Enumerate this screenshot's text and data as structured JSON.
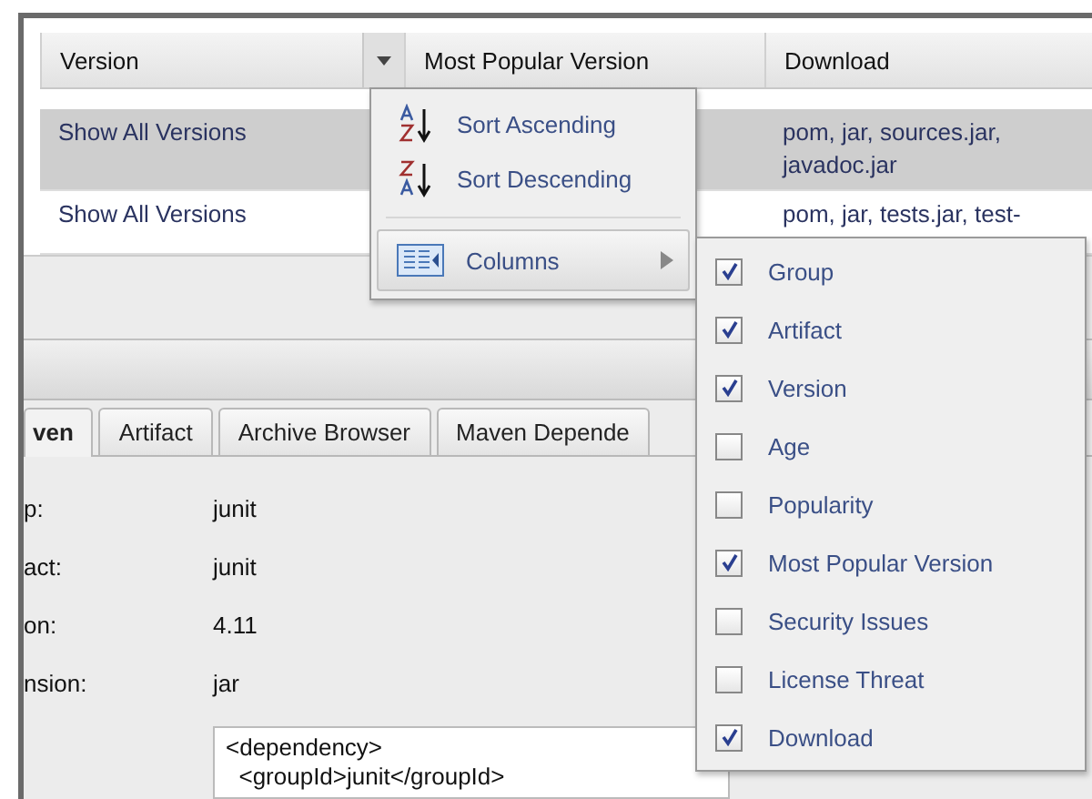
{
  "table": {
    "columns": [
      {
        "label": "Version",
        "menu_button": true
      },
      {
        "label": "Most Popular Version",
        "menu_button": false
      },
      {
        "label": "Download",
        "menu_button": false
      }
    ],
    "rows": [
      {
        "cells": [
          "Show All Versions",
          "",
          "pom, jar, sources.jar, javadoc.jar"
        ],
        "selected": true
      },
      {
        "cells": [
          "Show All Versions",
          "",
          "pom, jar, tests.jar, test-"
        ],
        "selected": false
      }
    ]
  },
  "column_menu": {
    "items": [
      {
        "kind": "sort_ascending",
        "label": "Sort Ascending",
        "highlighted": false
      },
      {
        "kind": "sort_descending",
        "label": "Sort Descending",
        "highlighted": false
      },
      {
        "kind": "separator"
      },
      {
        "kind": "submenu",
        "label": "Columns",
        "highlighted": true
      }
    ]
  },
  "columns_submenu": {
    "items": [
      {
        "label": "Group",
        "checked": true
      },
      {
        "label": "Artifact",
        "checked": true
      },
      {
        "label": "Version",
        "checked": true
      },
      {
        "label": "Age",
        "checked": false
      },
      {
        "label": "Popularity",
        "checked": false
      },
      {
        "label": "Most Popular Version",
        "checked": true
      },
      {
        "label": "Security Issues",
        "checked": false
      },
      {
        "label": "License Threat",
        "checked": false
      },
      {
        "label": "Download",
        "checked": true
      }
    ]
  },
  "tabs": [
    {
      "label": "ven",
      "selected": true
    },
    {
      "label": "Artifact",
      "selected": false
    },
    {
      "label": "Archive Browser",
      "selected": false
    },
    {
      "label": "Maven Depende",
      "selected": false
    }
  ],
  "fields": [
    {
      "label": "p:",
      "value": "junit"
    },
    {
      "label": "act:",
      "value": "junit"
    },
    {
      "label": "on:",
      "value": "4.11"
    },
    {
      "label": "nsion:",
      "value": "jar"
    }
  ],
  "snippet": {
    "lines": [
      "<dependency>",
      "  <groupId>junit</groupId>"
    ]
  }
}
